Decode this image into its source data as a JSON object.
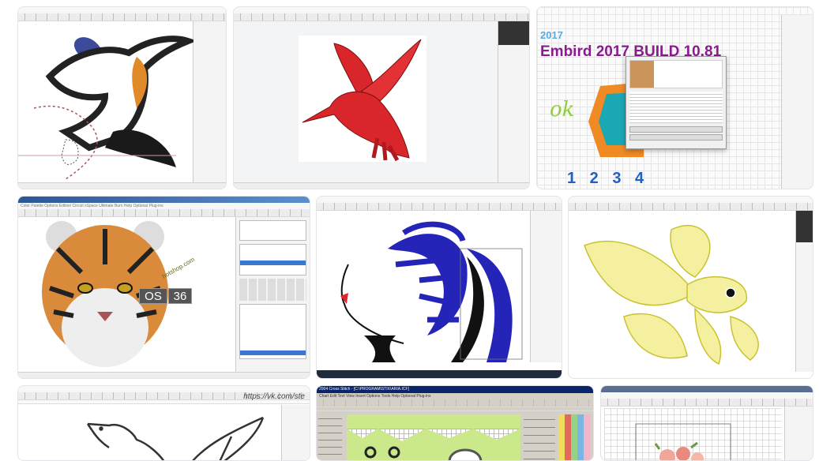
{
  "results": [
    {
      "id": 1,
      "subject": "hummingbird-outline-digitizing"
    },
    {
      "id": 2,
      "subject": "red-hummingbird-embroidery"
    },
    {
      "id": 3,
      "subject": "embird-2017",
      "header_year": "2017",
      "headline": "Embird 2017 BUILD 10.81",
      "doodle_text": "ok",
      "numbers": "1 2 3 4"
    },
    {
      "id": 4,
      "subject": "tiger-embroidery",
      "menu": "Color Palette  Options  Edition  Circuit  xSpace  Ultimate Burn  Help  Optional Plug-ins",
      "badge_left": "OS",
      "badge_right": "36",
      "badge_arc": "hotshop.com"
    },
    {
      "id": 5,
      "subject": "woman-profile-blue-hair"
    },
    {
      "id": 6,
      "subject": "yellow-goldfish"
    },
    {
      "id": 7,
      "subject": "bird-outline",
      "watermark": "https://vk.com/ste"
    },
    {
      "id": 8,
      "subject": "cross-stitch-pattern",
      "window_title": "2004 Cross Stitch - [C:\\PROGRAM\\STIX\\ARIA.ICF]",
      "menu": "Chart  Edit  Text  View  Insert  Options  Tools  Help  Optional Plug-ins"
    },
    {
      "id": 9,
      "subject": "flower-cross-stitch"
    }
  ],
  "colors": {
    "accent_red": "#e0262b",
    "hair_blue": "#2424b8",
    "embird_purple": "#8b1a8f",
    "fish_yellow": "#d9d23a",
    "title_navy": "#0a246a"
  }
}
